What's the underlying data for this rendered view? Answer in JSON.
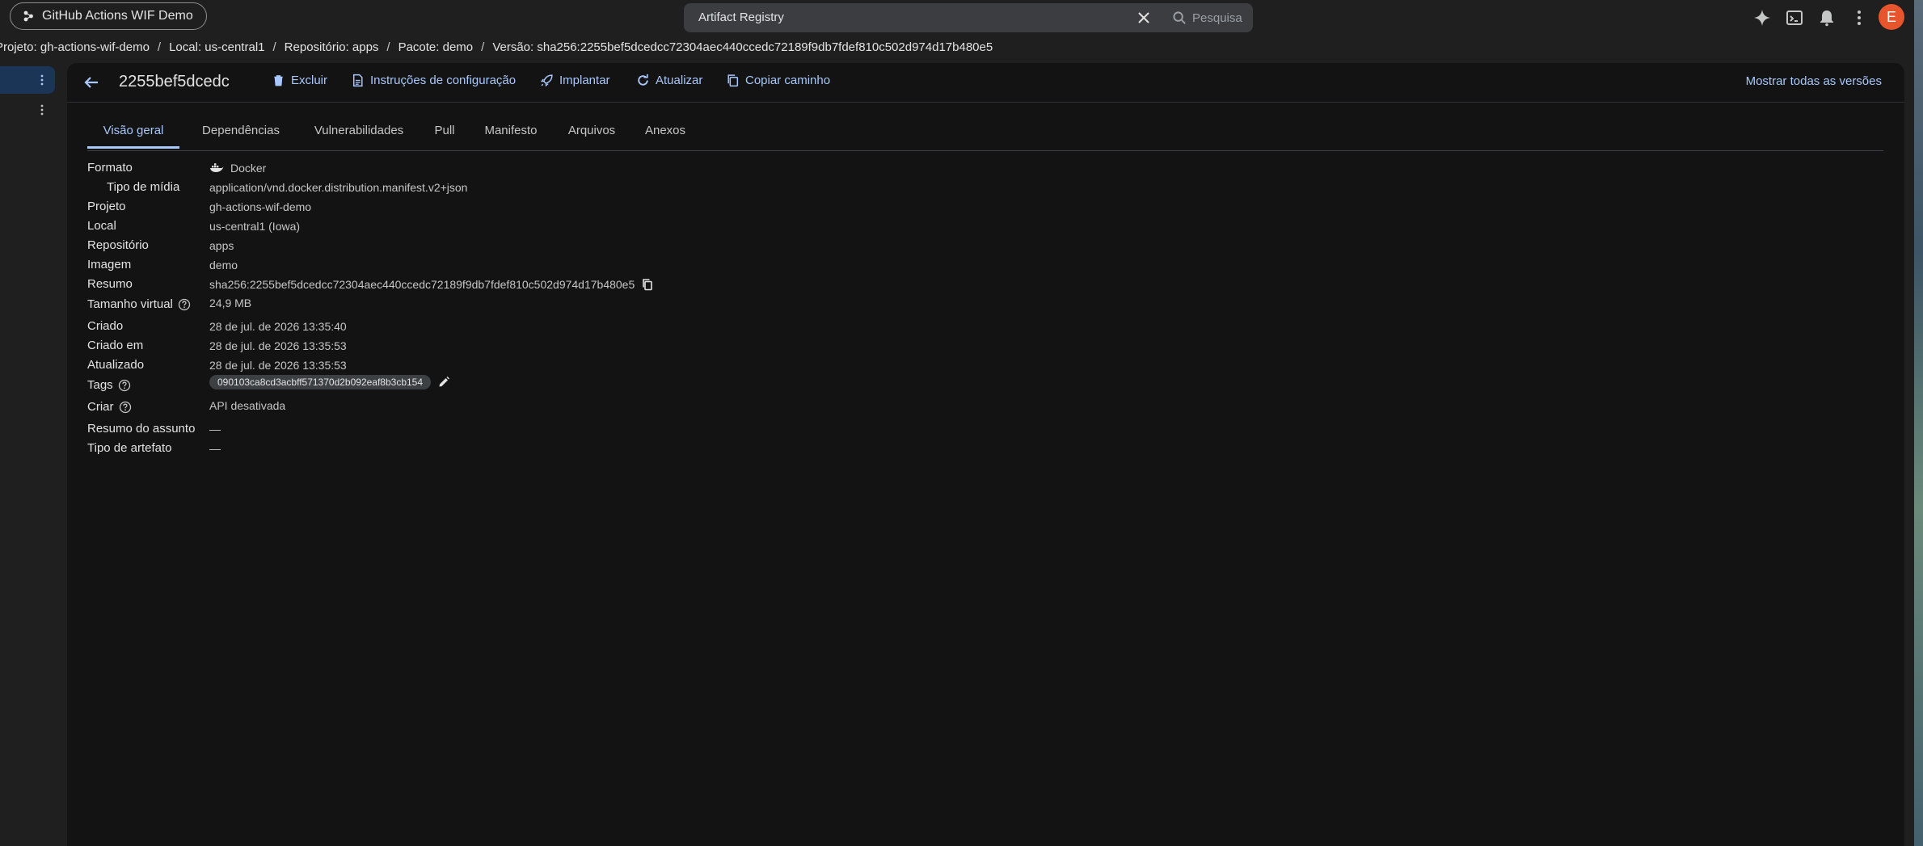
{
  "topbar": {
    "project_name": "GitHub Actions WIF Demo",
    "search_value": "Artifact Registry",
    "search_button_label": "Pesquisa",
    "avatar_initial": "E"
  },
  "breadcrumb": {
    "items": [
      "Projeto: gh-actions-wif-demo",
      "Local: us-central1",
      "Repositório: apps",
      "Pacote: demo",
      "Versão: sha256:2255bef5dcedcc72304aec440ccedc72189f9db7fdef810c502d974d17b480e5"
    ],
    "separator": "/"
  },
  "header": {
    "title": "2255bef5dcedc",
    "actions": {
      "delete": "Excluir",
      "setup": "Instruções de configuração",
      "deploy": "Implantar",
      "refresh": "Atualizar",
      "copy_path": "Copiar caminho"
    },
    "show_all_versions": "Mostrar todas as versões"
  },
  "tabs": [
    "Visão geral",
    "Dependências",
    "Vulnerabilidades",
    "Pull",
    "Manifesto",
    "Arquivos",
    "Anexos"
  ],
  "active_tab": "Visão geral",
  "details": {
    "format_label": "Formato",
    "format_value": "Docker",
    "media_type_label": "Tipo de mídia",
    "media_type_value": "application/vnd.docker.distribution.manifest.v2+json",
    "project_label": "Projeto",
    "project_value": "gh-actions-wif-demo",
    "location_label": "Local",
    "location_value": "us-central1 (Iowa)",
    "repository_label": "Repositório",
    "repository_value": "apps",
    "image_label": "Imagem",
    "image_value": "demo",
    "digest_label": "Resumo",
    "digest_value": "sha256:2255bef5dcedcc72304aec440ccedc72189f9db7fdef810c502d974d17b480e5",
    "virtual_size_label": "Tamanho virtual",
    "virtual_size_value": "24,9 MB",
    "created_label": "Criado",
    "created_value": "28 de jul. de 2026 13:35:40",
    "created_at_label": "Criado em",
    "created_at_value": "28 de jul. de 2026 13:35:53",
    "updated_label": "Atualizado",
    "updated_value": "28 de jul. de 2026 13:35:53",
    "tags_label": "Tags",
    "tag_value": "090103ca8cd3acbff571370d2b092eaf8b3cb154",
    "build_label": "Criar",
    "build_value": "API desativada",
    "subject_digest_label": "Resumo do assunto",
    "subject_digest_value": "—",
    "artifact_type_label": "Tipo de artefato",
    "artifact_type_value": "—"
  },
  "colors": {
    "accent": "#a8c7fa",
    "background": "#1f1f1f",
    "panel": "#131314",
    "avatar": "#e8552c"
  }
}
